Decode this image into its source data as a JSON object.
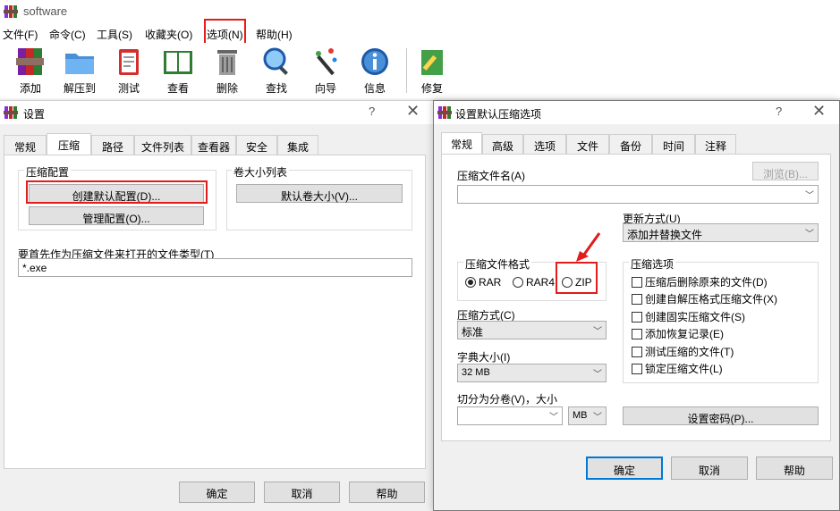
{
  "app": {
    "title": "software"
  },
  "menu": [
    "文件(F)",
    "命令(C)",
    "工具(S)",
    "收藏夹(O)",
    "选项(N)",
    "帮助(H)"
  ],
  "toolbar": [
    {
      "label": "添加",
      "icon": "add-archive-icon"
    },
    {
      "label": "解压到",
      "icon": "extract-folder-icon"
    },
    {
      "label": "测试",
      "icon": "test-clipboard-icon"
    },
    {
      "label": "查看",
      "icon": "view-book-icon"
    },
    {
      "label": "删除",
      "icon": "trash-icon"
    },
    {
      "label": "查找",
      "icon": "magnifier-icon"
    },
    {
      "label": "向导",
      "icon": "wizard-wand-icon"
    },
    {
      "label": "信息",
      "icon": "info-icon"
    },
    {
      "label": "修复",
      "icon": "repair-icon"
    }
  ],
  "settings": {
    "title": "设置",
    "help": "?",
    "close": "✕",
    "tabs": [
      "常规",
      "压缩",
      "路径",
      "文件列表",
      "查看器",
      "安全",
      "集成"
    ],
    "active_tab": "压缩",
    "compression_group": {
      "label": "压缩配置",
      "create_default": "创建默认配置(D)...",
      "manage": "管理配置(O)..."
    },
    "volume_group": {
      "label": "卷大小列表",
      "default_volume": "默认卷大小(V)..."
    },
    "filetypes_label": "要首先作为压缩文件来打开的文件类型(T)",
    "filetypes_value": "*.exe",
    "buttons": {
      "ok": "确定",
      "cancel": "取消",
      "help": "帮助"
    }
  },
  "default_dialog": {
    "title": "设置默认压缩选项",
    "help": "?",
    "close": "✕",
    "tabs": [
      "常规",
      "高级",
      "选项",
      "文件",
      "备份",
      "时间",
      "注释"
    ],
    "active_tab": "常规",
    "archive_name_label": "压缩文件名(A)",
    "browse": "浏览(B)...",
    "archive_name_value": "",
    "update_label": "更新方式(U)",
    "update_value": "添加并替换文件",
    "format_label": "压缩文件格式",
    "formats": [
      "RAR",
      "RAR4",
      "ZIP"
    ],
    "format_selected": "RAR",
    "options_label": "压缩选项",
    "options": [
      "压缩后删除原来的文件(D)",
      "创建自解压格式压缩文件(X)",
      "创建固实压缩文件(S)",
      "添加恢复记录(E)",
      "测试压缩的文件(T)",
      "锁定压缩文件(L)"
    ],
    "method_label": "压缩方式(C)",
    "method_value": "标准",
    "dict_label": "字典大小(I)",
    "dict_value": "32 MB",
    "split_label": "切分为分卷(V)，大小",
    "split_value": "",
    "split_unit": "MB",
    "password": "设置密码(P)...",
    "buttons": {
      "ok": "确定",
      "cancel": "取消",
      "help": "帮助"
    }
  },
  "colors": {
    "highlight": "#e21b1b",
    "focus": "#0078d7"
  }
}
